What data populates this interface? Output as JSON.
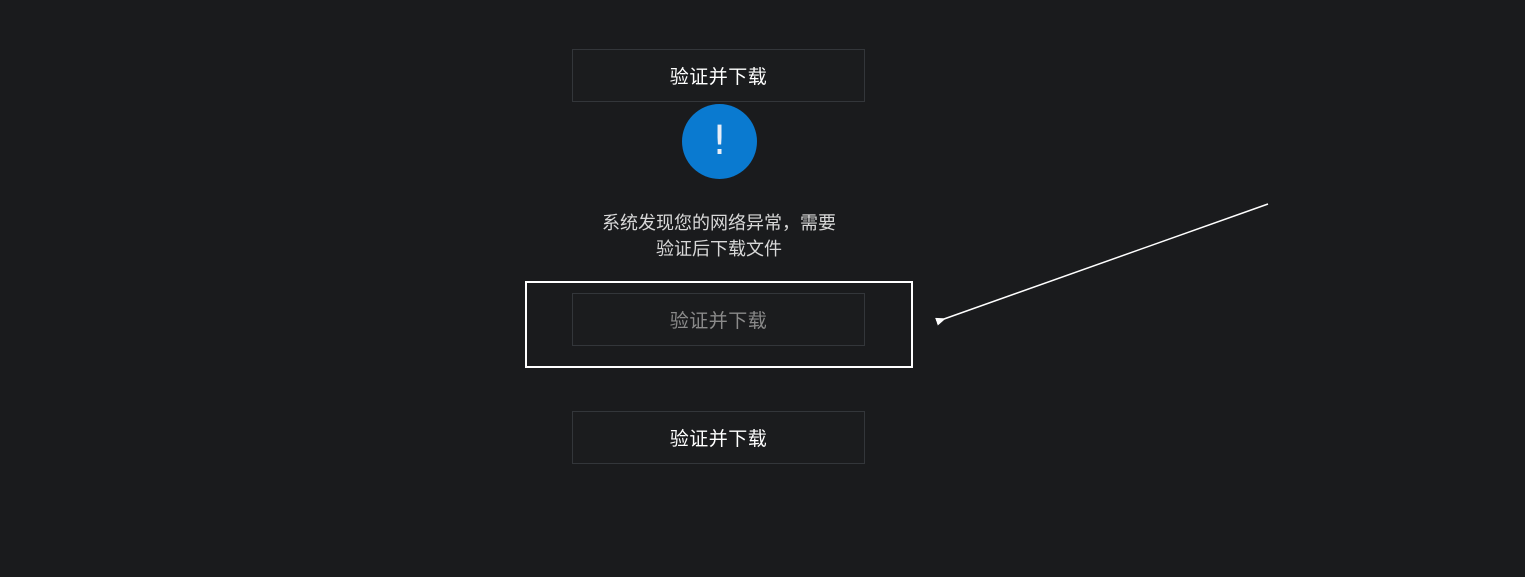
{
  "buttons": {
    "top_label": "验证并下载",
    "middle_label": "验证并下载",
    "bottom_label": "验证并下载"
  },
  "alert": {
    "icon": "exclamation-icon",
    "symbol": "!",
    "message_line1": "系统发现您的网络异常，需要",
    "message_line2": "验证后下载文件",
    "icon_color": "#0a7ad0"
  },
  "annotation": {
    "highlight_color": "#ffffff",
    "arrow_color": "#ffffff"
  }
}
